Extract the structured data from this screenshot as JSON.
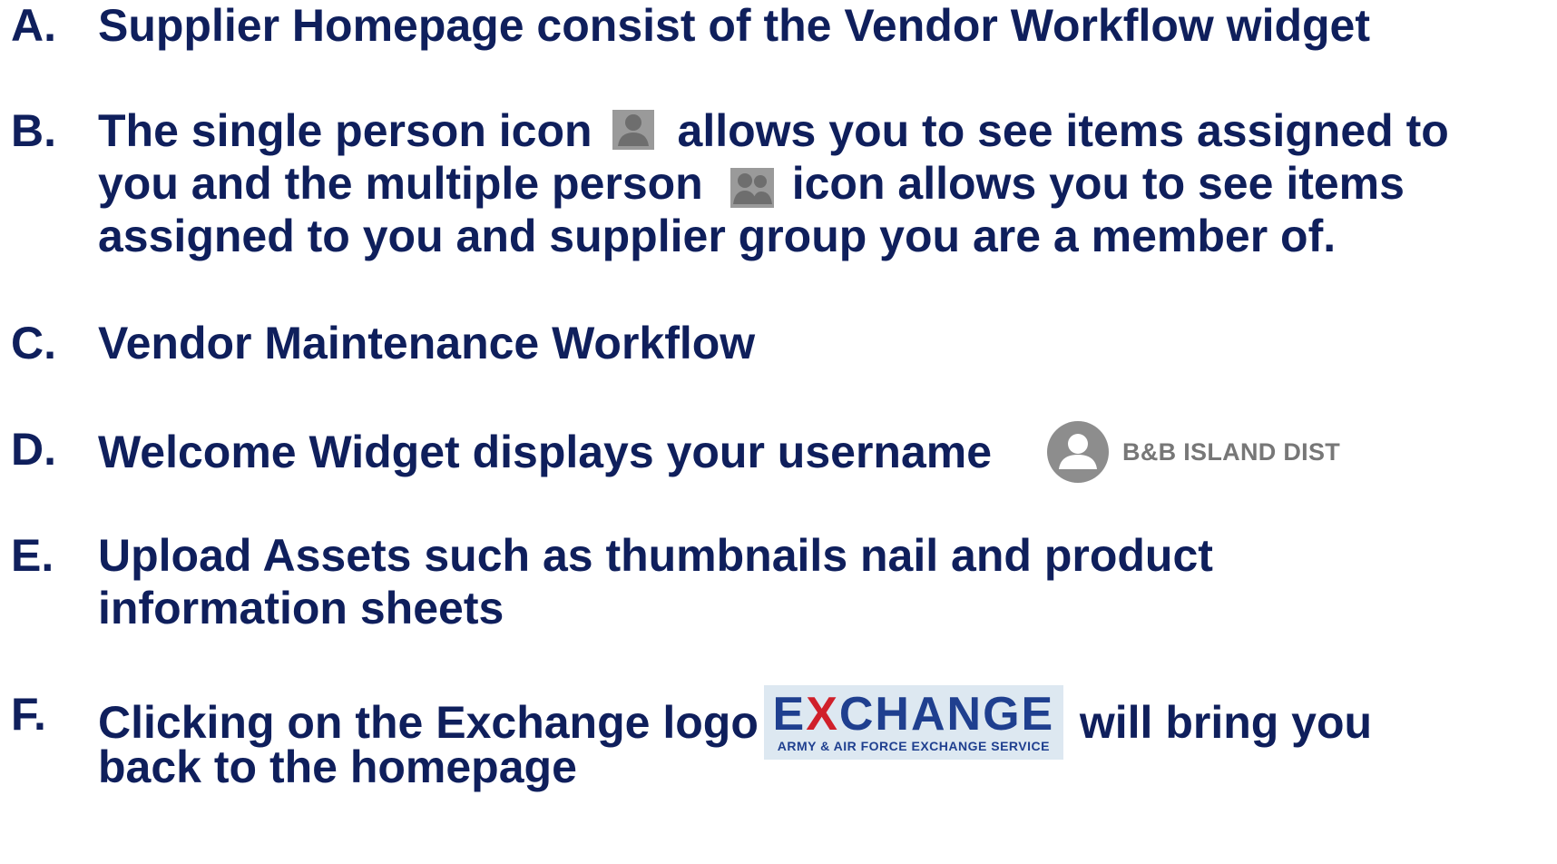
{
  "items": [
    {
      "letter": "A.",
      "lines": [
        "Supplier Homepage consist of the Vendor Workflow widget"
      ]
    },
    {
      "letter": "B.",
      "line1_before": "The single person icon",
      "line1_after": "allows you to see items assigned to",
      "line2_before": "you and the multiple person",
      "line2_after": "icon allows you to see items",
      "line3": "assigned to you and supplier group you are a member of."
    },
    {
      "letter": "C.",
      "lines": [
        "Vendor Maintenance Workflow"
      ]
    },
    {
      "letter": "D.",
      "text": "Welcome Widget displays your username",
      "username": "B&B ISLAND DIST"
    },
    {
      "letter": "E.",
      "lines": [
        "Upload Assets such as thumbnails nail and product",
        "information sheets"
      ]
    },
    {
      "letter": "F.",
      "line1_before": "Clicking on the Exchange logo",
      "line1_after": "will bring you",
      "line2": "back to the homepage",
      "logo_main_first": "E",
      "logo_main_x": "X",
      "logo_main_rest": "CHANGE",
      "logo_sub": "ARMY & AIR FORCE EXCHANGE SERVICE"
    }
  ],
  "colors": {
    "text": "#0f1f5c",
    "icon_gray": "#8a8a8a",
    "logo_blue": "#1f3f8f",
    "logo_red": "#d0202a",
    "logo_bg": "#dde8f1"
  },
  "icons": [
    "single-person-icon",
    "multiple-person-icon",
    "user-avatar-icon",
    "exchange-logo"
  ]
}
